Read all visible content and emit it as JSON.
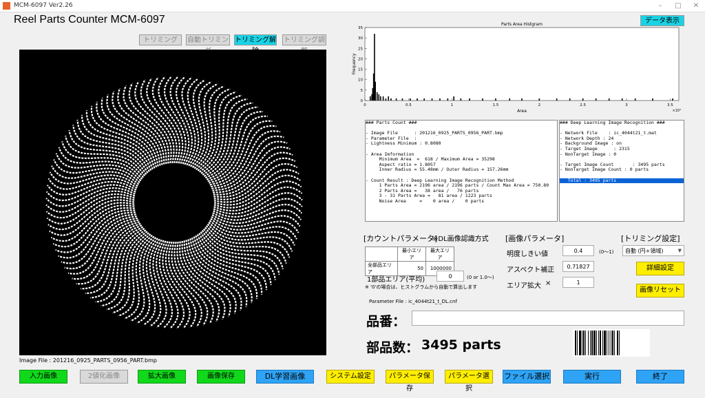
{
  "window": {
    "title": "MCM-6097 Ver2.26"
  },
  "app": {
    "title": "Reel Parts Counter  MCM-6097"
  },
  "trim_buttons": [
    "トリミング",
    "自動トリミング",
    "トリミング解除",
    "トリミング調整"
  ],
  "data_button": "データ表示",
  "image": {
    "file_label": "Image File : 201216_0925_PARTS_0956_PART.bmp"
  },
  "chart_data": {
    "type": "bar",
    "title": "Parts Area Histgram",
    "xlabel": "Area",
    "ylabel": "Frequency",
    "xlim": [
      0,
      36000
    ],
    "ylim": [
      0,
      35
    ],
    "x_exponent_label": "×10⁴",
    "xticks": [
      "0",
      "0.5",
      "1",
      "1.5",
      "2",
      "2.5",
      "3",
      "3.5"
    ],
    "yticks": [
      "0",
      "5",
      "10",
      "15",
      "20",
      "25",
      "30",
      "35"
    ],
    "x": [
      618,
      800,
      900,
      1000,
      1100,
      1200,
      1400,
      1600,
      1800,
      2100,
      2400,
      2700,
      3000,
      3600,
      4300,
      5200,
      6000,
      6800,
      7700,
      8600,
      9500,
      10200,
      11000,
      12000,
      13500,
      15000,
      16600,
      18000,
      20000,
      22000,
      23500,
      25000,
      26500,
      28000,
      29500,
      31000,
      33000,
      35298
    ],
    "values": [
      2,
      3,
      6,
      13,
      32,
      9,
      4,
      3,
      2,
      2,
      1,
      2,
      1,
      1,
      1,
      1,
      1,
      1,
      1,
      1,
      1,
      2,
      1,
      1,
      1,
      1,
      1,
      1,
      1,
      1,
      1,
      1,
      1,
      1,
      1,
      1,
      1,
      1
    ],
    "grid": false,
    "legend": "none"
  },
  "parts_count": {
    "lines": [
      "### Parts Count ###",
      "",
      "- Image File      : 201216_0925_PARTS_0956_PART.bmp",
      "- Parameter File  :",
      "- Lightness Minimum : 0.8080",
      "",
      "- Area Imformation",
      "     Minimum Area  =  618 / Maximum Area = 35298",
      "     Aspect ratio = 1.8057",
      "     Inner Radius = 55.48mm / Outer Radius = 157.26mm",
      "",
      "- Count Result : Deep Learning Image Recognition Method",
      "     1 Parts Area = 2196 area / 2196 parts / Count Max Area = 750.80",
      "     2 Parts Area =   38 area /   76 parts",
      "     3 - 31 Parts Area =   81 area / 1223 parts",
      "     Noise Area     =    0 area /    0 parts",
      "",
      "",
      "",
      "",
      "   Total : 3495 parts"
    ]
  },
  "dl_recognition": {
    "lines": [
      "### Deep Learning Image Recognition ###",
      "",
      "- Network File    : ic_4044t21_t.mat",
      "- Network Depth : 24",
      "- Background Image : on",
      "- Target Image      : 2315",
      "- NonTarget Image : 0",
      "",
      "- Target Image Count       : 3495 parts",
      "- NonTarget Image Count : 0 parts",
      "",
      "   Total : 3495 parts"
    ]
  },
  "count_params": {
    "header": "[カウントパラメータ]",
    "method": "※DL画像認識方式",
    "table_headers": [
      "",
      "最小エリア",
      "最大エリア"
    ],
    "table_row": [
      "全部品エリア",
      "50",
      "1000000"
    ],
    "avg_label": "1部品エリア(平均)",
    "avg_value": "0",
    "avg_range": "(0 or 1.0〜)",
    "note": "※ '0'の場合は、ヒストグラムから自動で算出します",
    "param_file": "Parameter File : ic_4044t21_t_DL.cnf"
  },
  "image_params": {
    "header": "[画像パラメータ]",
    "brightness_label": "明度しきい値",
    "brightness_value": "0.4",
    "brightness_range": "(0〜1)",
    "aspect_label": "アスペクト補正",
    "aspect_value": "0.71827",
    "zoom_label": "エリア拡大",
    "zoom_x": "×",
    "zoom_value": "1"
  },
  "trim_settings": {
    "header": "[トリミング設定]",
    "mode": "自動 (円+領域)",
    "detail_button": "詳細設定",
    "reset_button": "画像リセット"
  },
  "part_no": {
    "label": "品番：",
    "value": ""
  },
  "result": {
    "label": "部品数：",
    "value": "3495 parts"
  },
  "bottom_buttons": [
    "入力画像",
    "2値化画像",
    "拡大画像",
    "画像保存",
    "DL学習画像",
    "システム設定",
    "パラメータ保存",
    "パラメータ選択",
    "ファイル選択",
    "実行",
    "終了"
  ]
}
